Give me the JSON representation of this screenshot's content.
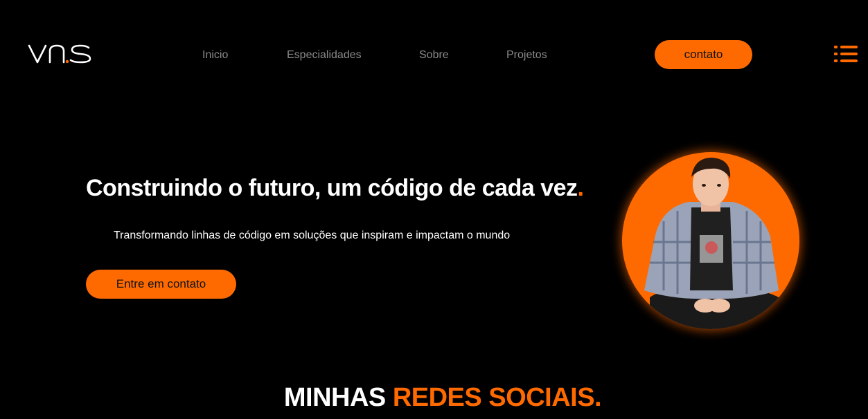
{
  "header": {
    "logo_text": "vns",
    "nav": [
      {
        "label": "Inicio"
      },
      {
        "label": "Especialidades"
      },
      {
        "label": "Sobre"
      },
      {
        "label": "Projetos"
      }
    ],
    "contact_label": "contato",
    "menu_icon": "hamburger-list-icon"
  },
  "hero": {
    "title": "Construindo o futuro, um código de cada vez",
    "title_dot": ".",
    "subtitle": "Transformando linhas de código em soluções que inspiram e impactam o mundo",
    "cta_label": "Entre em contato",
    "photo_icon": "profile-photo"
  },
  "social": {
    "title_white": "MINHAS",
    "title_orange": "REDES SOCIAIS."
  },
  "colors": {
    "background": "#000000",
    "accent": "#ff6a00",
    "nav_text": "#8a8a8a",
    "text": "#ffffff"
  }
}
